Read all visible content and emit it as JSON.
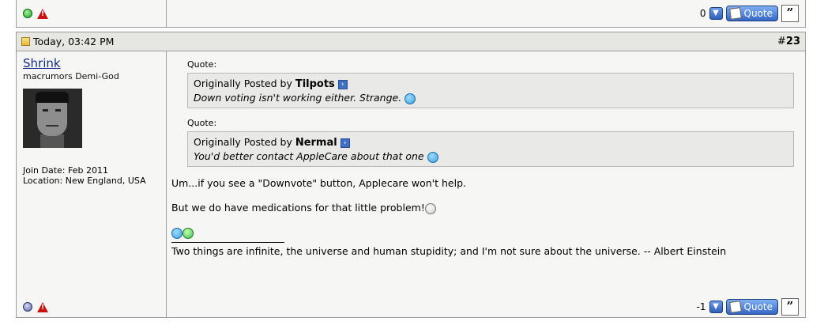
{
  "prev_post": {
    "vote_count": "0",
    "quote_label": "Quote"
  },
  "post": {
    "timestamp": "Today, 03:42 PM",
    "number_prefix": "#",
    "number": "23",
    "user": {
      "name": "Shrink",
      "title": "macrumors Demi-God",
      "join_date": "Join Date: Feb 2011",
      "location": "Location: New England, USA"
    },
    "quotes": [
      {
        "label": "Quote:",
        "posted_by_prefix": "Originally Posted by",
        "author": "Tilpots",
        "text": "Down voting isn't working either. Strange."
      },
      {
        "label": "Quote:",
        "posted_by_prefix": "Originally Posted by",
        "author": "Nermal",
        "text": "You'd better contact AppleCare about that one"
      }
    ],
    "paragraphs": [
      "Um...if you see a \"Downvote\" button, Applecare won't help.",
      "But we do have medications for that little problem!"
    ],
    "signature": "Two things are infinite, the universe and human stupidity; and I'm not sure about the universe. -- Albert Einstein",
    "vote_count": "-1",
    "quote_label": "Quote"
  },
  "icons": {
    "online": "online-status-icon",
    "offline": "offline-status-icon",
    "report": "report-icon",
    "post": "post-icon",
    "view_post": "view-post-icon",
    "downvote": "downvote-icon",
    "multiquote": "multiquote-icon",
    "smiley": "smiley-icon"
  },
  "colors": {
    "username": "#102a8c",
    "header_bg": "#e6e6e3",
    "quote_bg": "#e9e9e7",
    "button": "#3566c6",
    "report": "#cc1111"
  }
}
